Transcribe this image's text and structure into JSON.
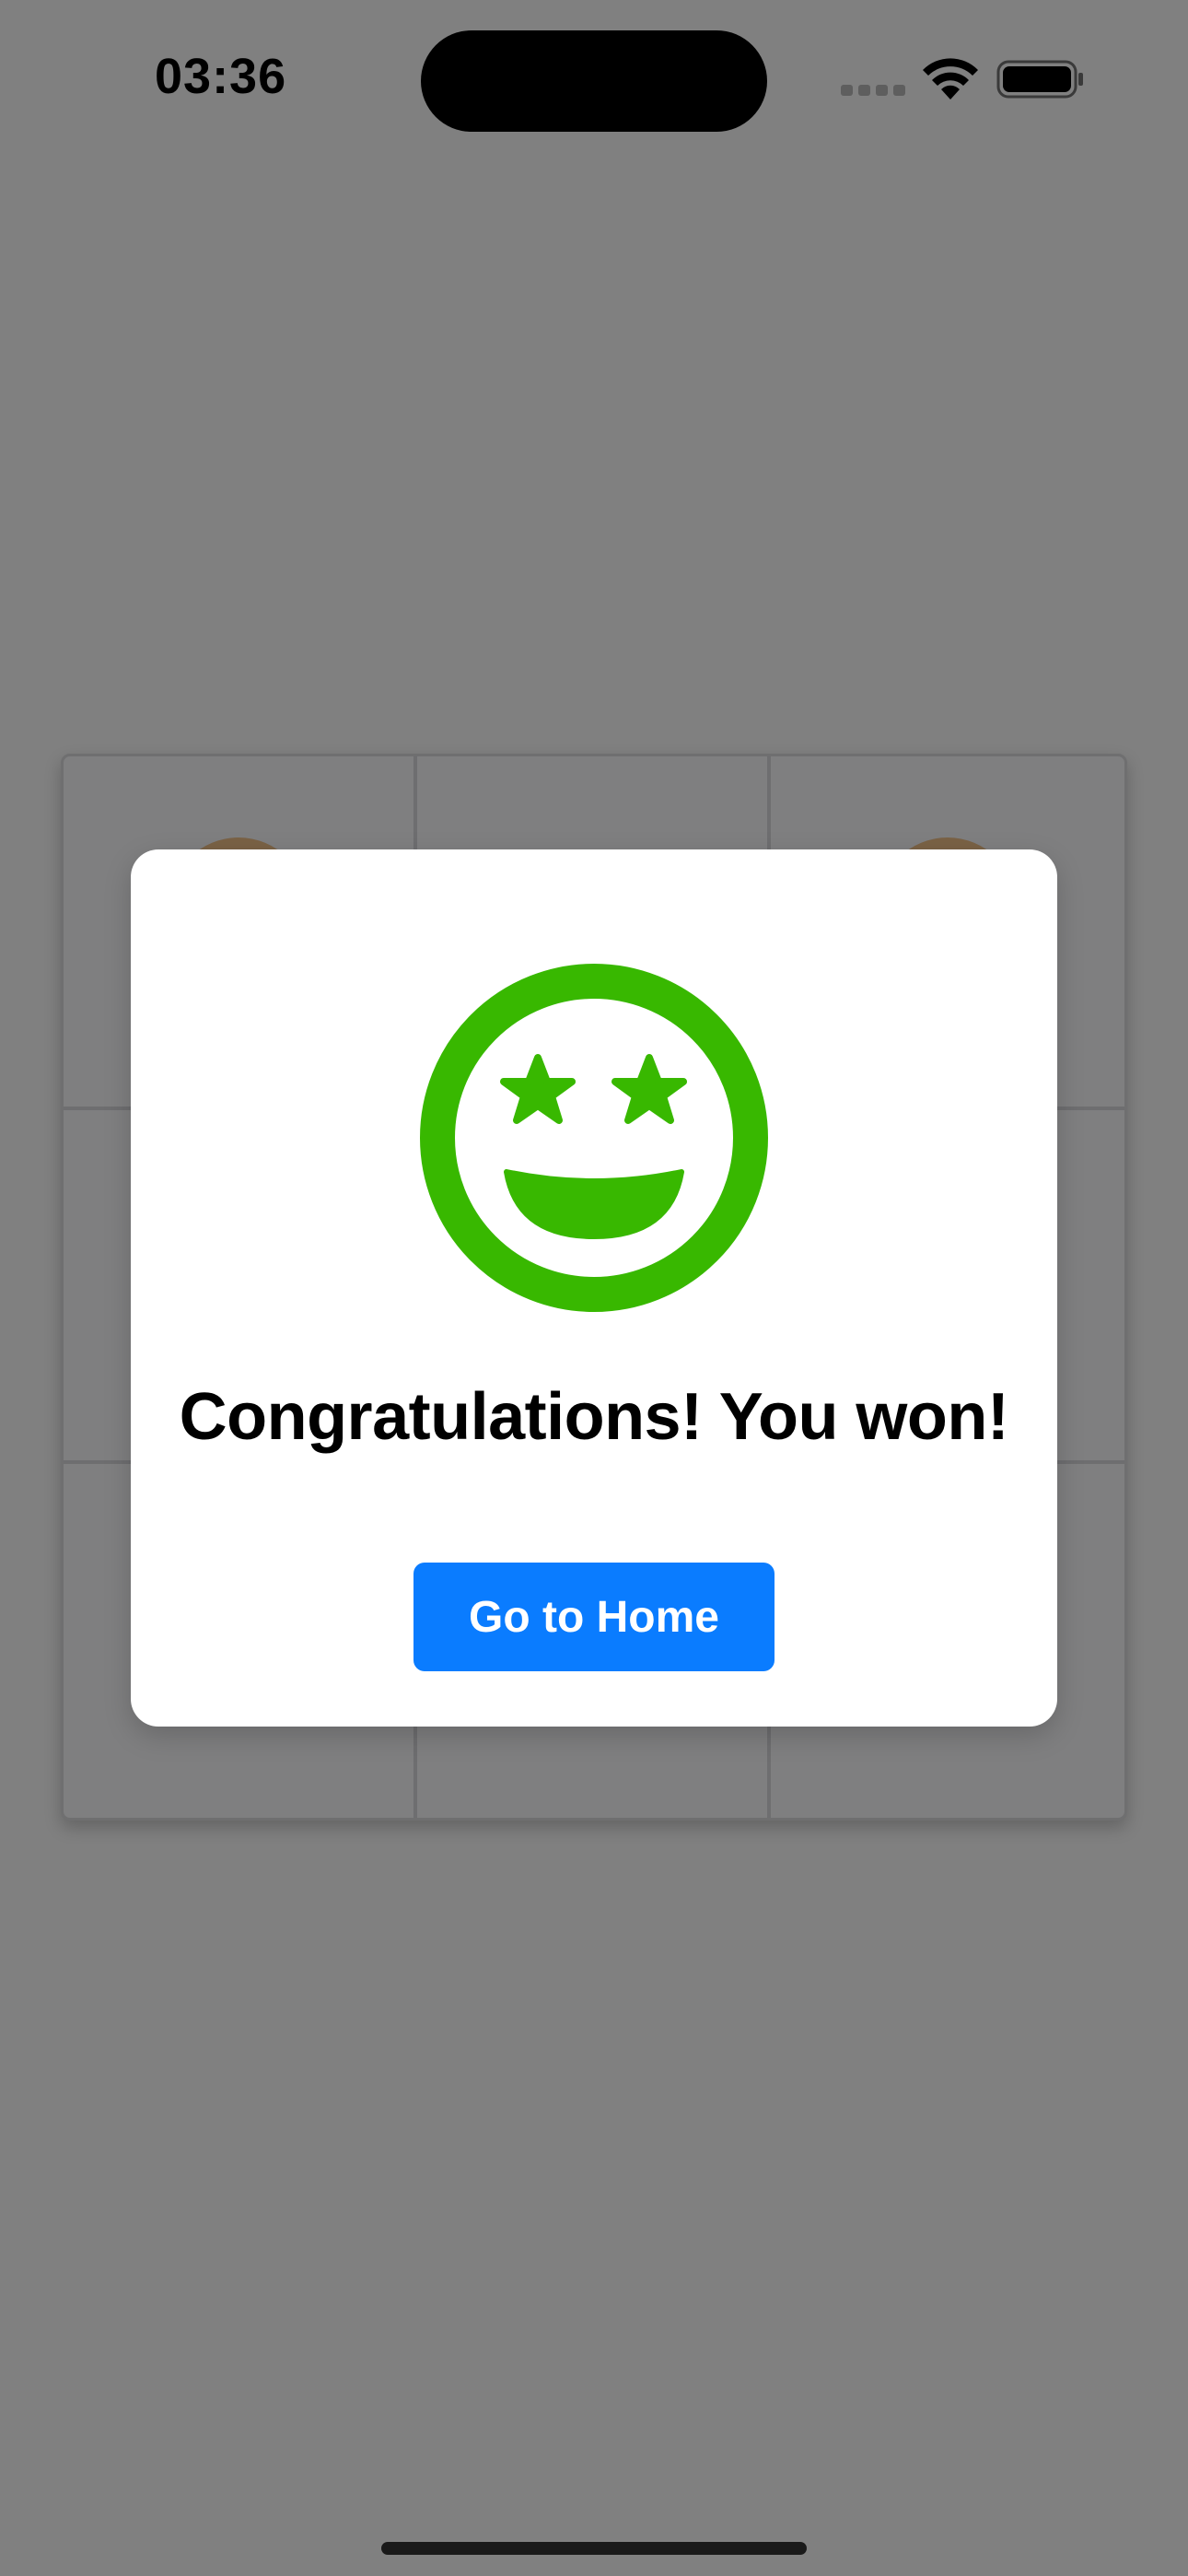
{
  "status_bar": {
    "time": "03:36"
  },
  "icons": {
    "cellular": "cellular-signal-icon",
    "wifi": "wifi-icon",
    "battery": "battery-icon",
    "result": "star-struck-smiley-icon"
  },
  "board": {
    "rows": 3,
    "columns": 3
  },
  "modal": {
    "title": "Congratulations! You won!",
    "button_label": "Go to Home"
  },
  "colors": {
    "overlay_background": "#808080",
    "win_icon": "#38b800",
    "button": "#0a7cff",
    "piece": "#7a6245"
  }
}
